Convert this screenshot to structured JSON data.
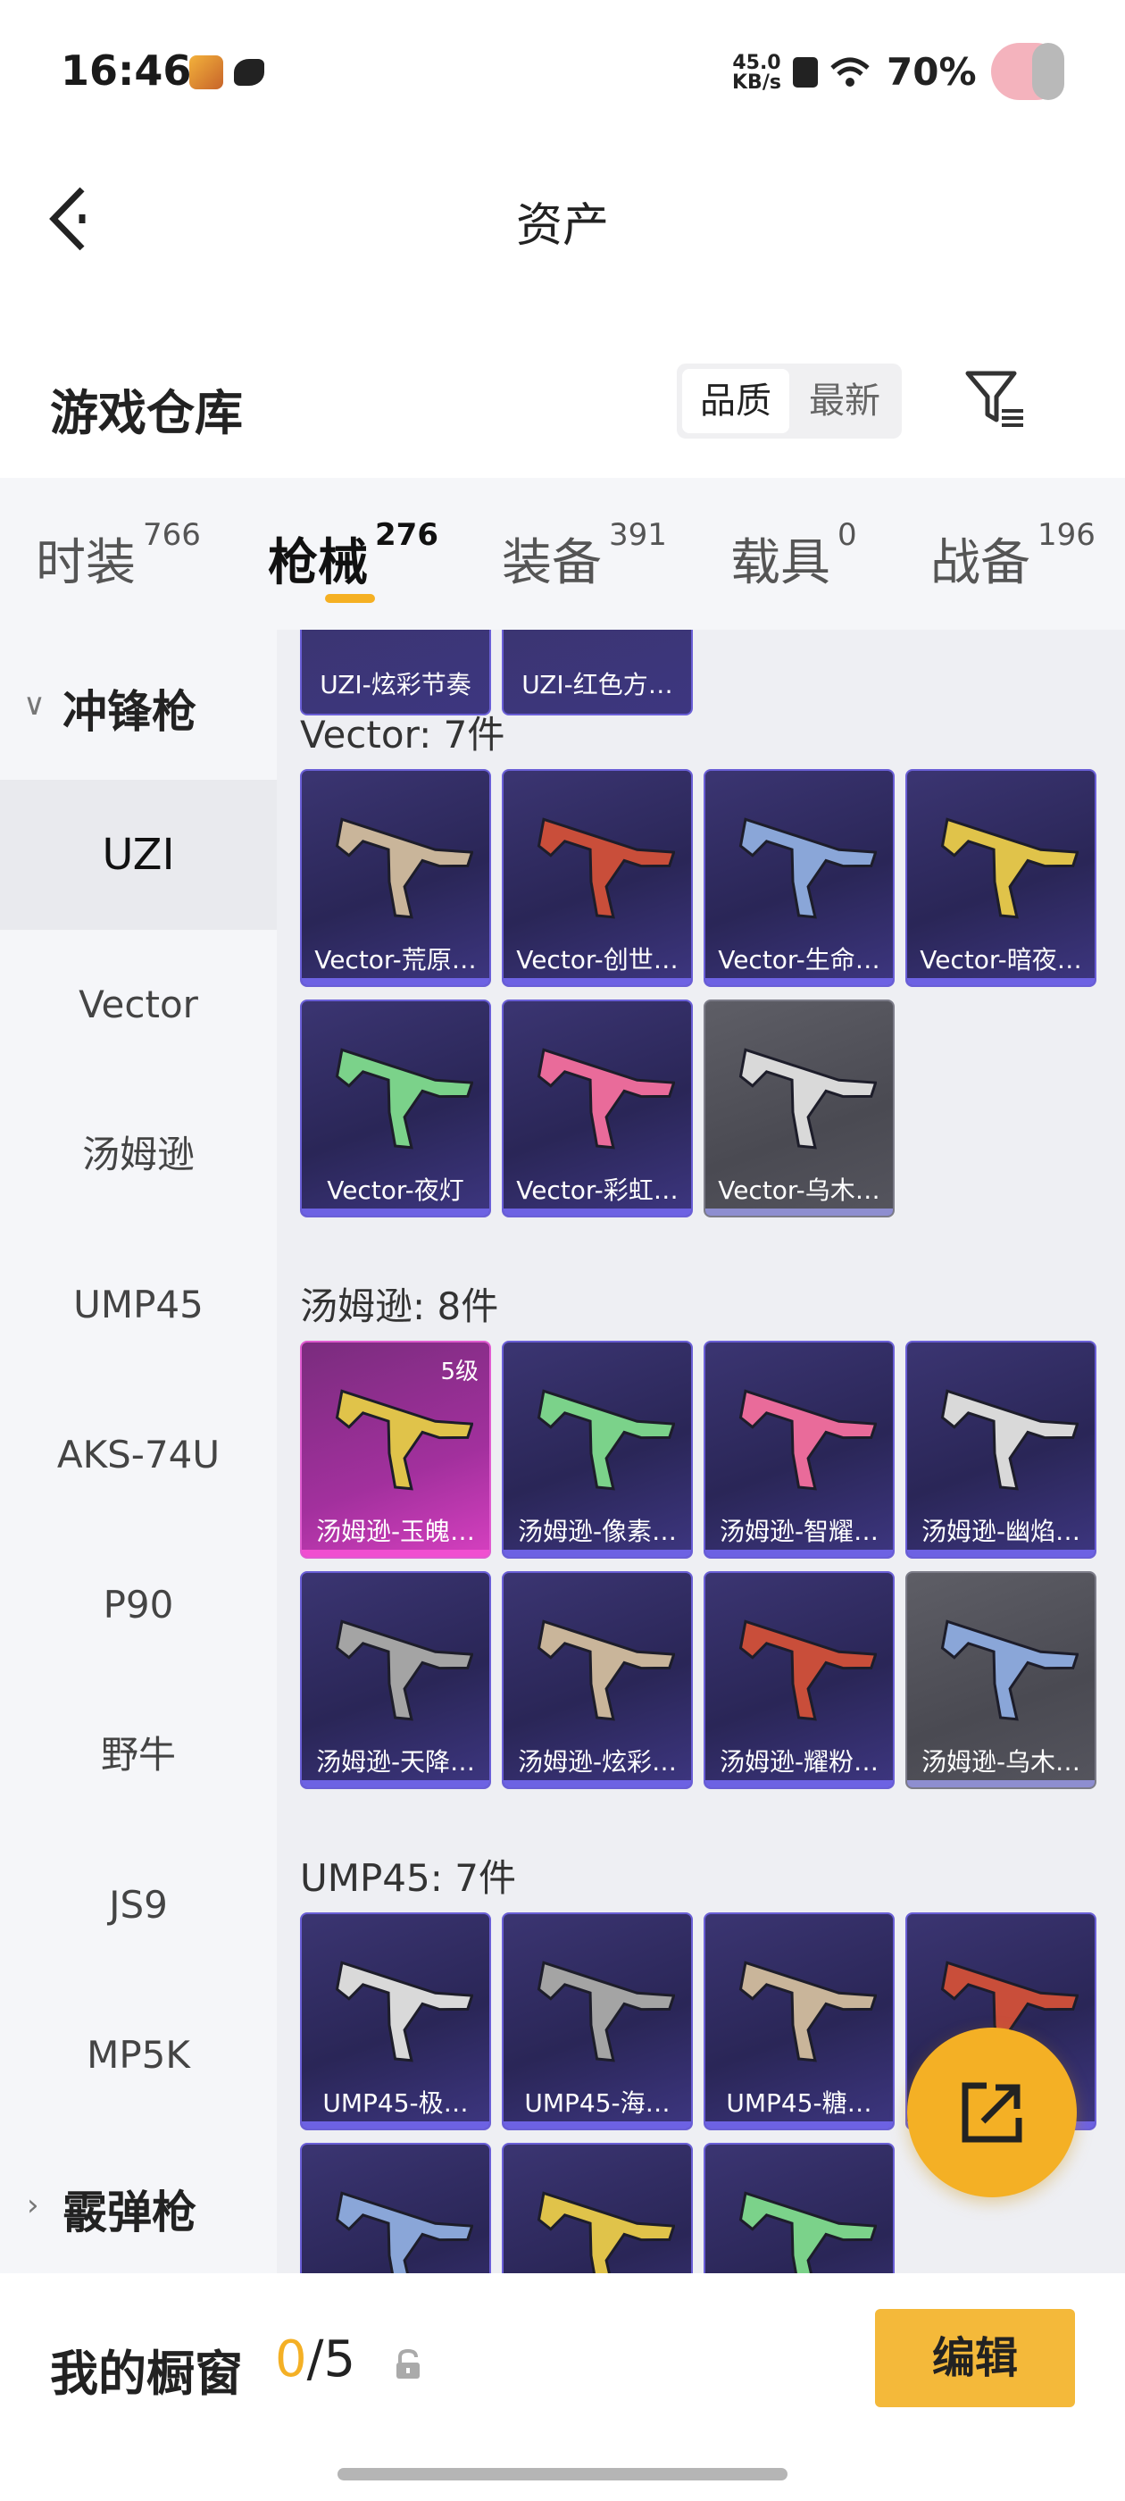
{
  "status_bar": {
    "time": "16:46",
    "net_speed_value": "45.0",
    "net_speed_unit": "KB/s",
    "battery": "70%"
  },
  "header": {
    "title": "资产"
  },
  "warehouse": {
    "title": "游戏仓库",
    "sort_options": [
      "品质",
      "最新"
    ],
    "active_sort": "品质"
  },
  "tabs": [
    {
      "label": "时装",
      "count": "766"
    },
    {
      "label": "枪械",
      "count": "276",
      "active": true
    },
    {
      "label": "装备",
      "count": "391"
    },
    {
      "label": "载具",
      "count": "0"
    },
    {
      "label": "战备",
      "count": "196"
    }
  ],
  "sidebar": {
    "category_expanded": "冲锋枪",
    "items": [
      "UZI",
      "Vector",
      "汤姆逊",
      "UMP45",
      "AKS-74U",
      "P90",
      "野牛",
      "JS9",
      "MP5K"
    ],
    "active_item": "UZI",
    "category_collapsed": "霰弹枪"
  },
  "content": {
    "prev_items": [
      "UZI-炫彩节奏",
      "UZI-红色方…"
    ],
    "sections": [
      {
        "title": "Vector: 7件",
        "items": [
          {
            "name": "Vector-荒原…",
            "rarity": "purple"
          },
          {
            "name": "Vector-创世…",
            "rarity": "purple"
          },
          {
            "name": "Vector-生命…",
            "rarity": "purple"
          },
          {
            "name": "Vector-暗夜…",
            "rarity": "purple"
          },
          {
            "name": "Vector-夜灯",
            "rarity": "purple"
          },
          {
            "name": "Vector-彩虹…",
            "rarity": "purple"
          },
          {
            "name": "Vector-乌木…",
            "rarity": "grey"
          }
        ]
      },
      {
        "title": "汤姆逊: 8件",
        "items": [
          {
            "name": "汤姆逊-玉魄…",
            "rarity": "pink",
            "level": "5级"
          },
          {
            "name": "汤姆逊-像素…",
            "rarity": "purple"
          },
          {
            "name": "汤姆逊-智耀…",
            "rarity": "purple"
          },
          {
            "name": "汤姆逊-幽焰…",
            "rarity": "purple"
          },
          {
            "name": "汤姆逊-天降…",
            "rarity": "purple"
          },
          {
            "name": "汤姆逊-炫彩…",
            "rarity": "purple"
          },
          {
            "name": "汤姆逊-耀粉…",
            "rarity": "purple"
          },
          {
            "name": "汤姆逊-乌木…",
            "rarity": "grey"
          }
        ]
      },
      {
        "title": "UMP45: 7件",
        "items": [
          {
            "name": "UMP45-极…",
            "rarity": "purple"
          },
          {
            "name": "UMP45-海…",
            "rarity": "purple"
          },
          {
            "name": "UMP45-糖…",
            "rarity": "purple"
          },
          {
            "name": "",
            "rarity": "purple"
          },
          {
            "name": "",
            "rarity": "purple"
          },
          {
            "name": "",
            "rarity": "purple"
          },
          {
            "name": "",
            "rarity": "purple"
          }
        ]
      }
    ]
  },
  "showcase": {
    "label": "我的橱窗",
    "used": "0",
    "separator_total": "/5",
    "edit_label": "编辑"
  },
  "colors": {
    "accent": "#f4b025",
    "card_purple": "#2a2657",
    "card_border_purple": "#6a5fd6",
    "card_pink": "#a2309d",
    "card_grey": "#4a4a52"
  },
  "icons": [
    "back-arrow-icon",
    "filter-icon",
    "chevron-down-icon",
    "chevron-right-icon",
    "share-out-icon",
    "lock-icon",
    "wifi-icon",
    "sim-icon"
  ]
}
